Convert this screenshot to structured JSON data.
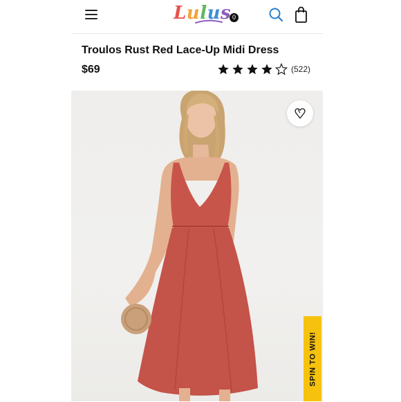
{
  "header": {
    "logo_text": "Lulus",
    "bag_count": "0"
  },
  "product": {
    "title": "Troulos Rust Red Lace-Up Midi Dress",
    "price": "$69",
    "rating": 4,
    "rating_max": 5,
    "review_count": "(522)"
  },
  "image": {
    "alt": "Model wearing rust red lace-up midi dress"
  },
  "promo": {
    "spin_label": "SPIN TO WIN!"
  },
  "colors": {
    "dress": "#c8554a",
    "promo_bg": "#f6c20e",
    "text": "#111111"
  },
  "icons": [
    "menu-icon",
    "search-icon",
    "shopping-bag-icon",
    "heart-icon",
    "star-icon"
  ]
}
